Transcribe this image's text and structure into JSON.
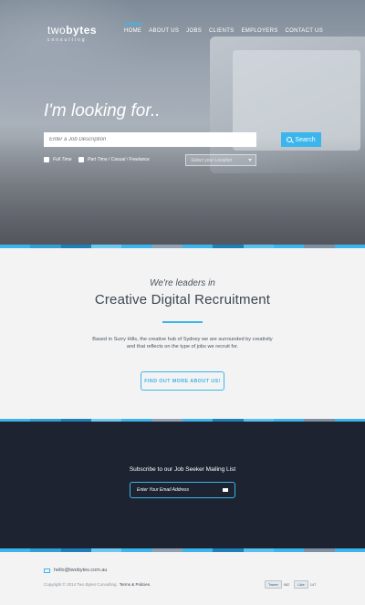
{
  "logo": {
    "main_light": "two",
    "main_bold": "bytes",
    "sub": "consulting"
  },
  "nav": {
    "items": [
      {
        "label": "HOME",
        "active": true
      },
      {
        "label": "ABOUT US",
        "active": false
      },
      {
        "label": "JOBS",
        "active": false
      },
      {
        "label": "CLIENTS",
        "active": false
      },
      {
        "label": "EMPLOYERS",
        "active": false
      },
      {
        "label": "CONTACT US",
        "active": false
      }
    ]
  },
  "hero": {
    "heading": "I'm looking for..",
    "search_placeholder": "Enter a Job Description",
    "search_button": "Search",
    "checkbox_1": "Full Time",
    "checkbox_2": "Part Time / Casual / Freelance",
    "location_placeholder": "Select your Location"
  },
  "about": {
    "leaders": "We're leaders in",
    "title": "Creative Digital Recruitment",
    "description": "Based in Surry Hills, the creative hub of Sydney we are surrounded by creativity and that reflects on the type of jobs we recruit for.",
    "button": "FIND OUT MORE ABOUT US!"
  },
  "subscribe": {
    "title": "Subscribe to our Job Seeker Mailing List",
    "email_placeholder": "Enter Your Email Address"
  },
  "footer": {
    "email": "hello@twobytes.com.au",
    "copyright": "Copyright © 2014 Two Bytes Consulting.",
    "policies": "Terms & Policies.",
    "tweet_label": "Tweet",
    "tweet_count": "982",
    "like_label": "Like",
    "like_count": "147"
  },
  "colors": {
    "accent": "#3bb5ec",
    "dark": "#1d2330",
    "light_bg": "#f3f3f3"
  },
  "stripe_colors": [
    "#3bb5ec",
    "#2f9fd6",
    "#1f7fb8",
    "#6cc8f2",
    "#3bb5ec",
    "#8fa1b5",
    "#3bb5ec",
    "#1f7fb8",
    "#56c1ee",
    "#3bb5ec",
    "#7d8fa3",
    "#3bb5ec"
  ]
}
